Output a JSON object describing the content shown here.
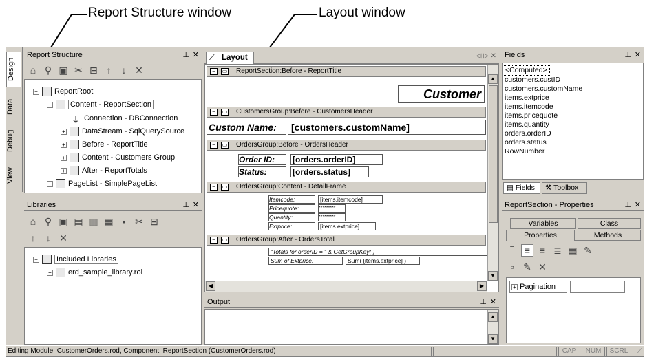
{
  "callouts": {
    "report_structure": "Report Structure window",
    "layout": "Layout window"
  },
  "side_tabs": [
    "Design",
    "Data",
    "Debug",
    "View"
  ],
  "report_structure": {
    "title": "Report Structure",
    "tree": [
      "ReportRoot",
      "Content - ReportSection",
      "Connection - DBConnection",
      "DataStream - SqlQuerySource",
      "Before - ReportTitle",
      "Content - Customers Group",
      "After - ReportTotals",
      "PageList - SimplePageList"
    ]
  },
  "libraries": {
    "title": "Libraries",
    "tree": [
      "Included Libraries",
      "erd_sample_library.rol"
    ]
  },
  "layout": {
    "tab": "Layout",
    "nav": "◁ ▷ ✕",
    "sections": [
      "ReportSection:Before - ReportTitle",
      "CustomersGroup:Before - CustomersHeader",
      "OrdersGroup:Before - OrdersHeader",
      "OrdersGroup:Content - DetailFrame",
      "OrdersGroup:After - OrdersTotal"
    ],
    "report_title": "Customer",
    "custom_name_label": "Custom Name:",
    "custom_name_field": "[customers.customName]",
    "order_id_label": "Order ID:",
    "order_id_field": "[orders.orderID]",
    "status_label": "Status:",
    "status_field": "[orders.status]",
    "detail": [
      {
        "label": "Itemcode:",
        "value": "[items.itemcode]"
      },
      {
        "label": "Pricequote:",
        "value": "*********"
      },
      {
        "label": "Quantity:",
        "value": "*********"
      },
      {
        "label": "Extprice:",
        "value": "[items.extprice]"
      }
    ],
    "totals_expr": "\"Totals for orderID = \" & GetGroupKey( )",
    "sum_label": "Sum of Extprice:",
    "sum_field": "Sum( [items.extprice] )"
  },
  "output": {
    "title": "Output"
  },
  "fields": {
    "title": "Fields",
    "items": [
      "<Computed>",
      "customers.custID",
      "customers.customName",
      "items.extprice",
      "items.itemcode",
      "items.pricequote",
      "items.quantity",
      "orders.orderID",
      "orders.status",
      "RowNumber"
    ],
    "tab_fields": "Fields",
    "tab_toolbox": "Toolbox"
  },
  "properties": {
    "title": "ReportSection - Properties",
    "tabs": [
      "Variables",
      "Class",
      "Properties",
      "Methods"
    ],
    "row_label": "Pagination"
  },
  "status_bar": {
    "text": "Editing Module: CustomerOrders.rod,  Component: ReportSection (CustomerOrders.rod)",
    "cap": "CAP",
    "num": "NUM",
    "scrl": "SCRL"
  }
}
